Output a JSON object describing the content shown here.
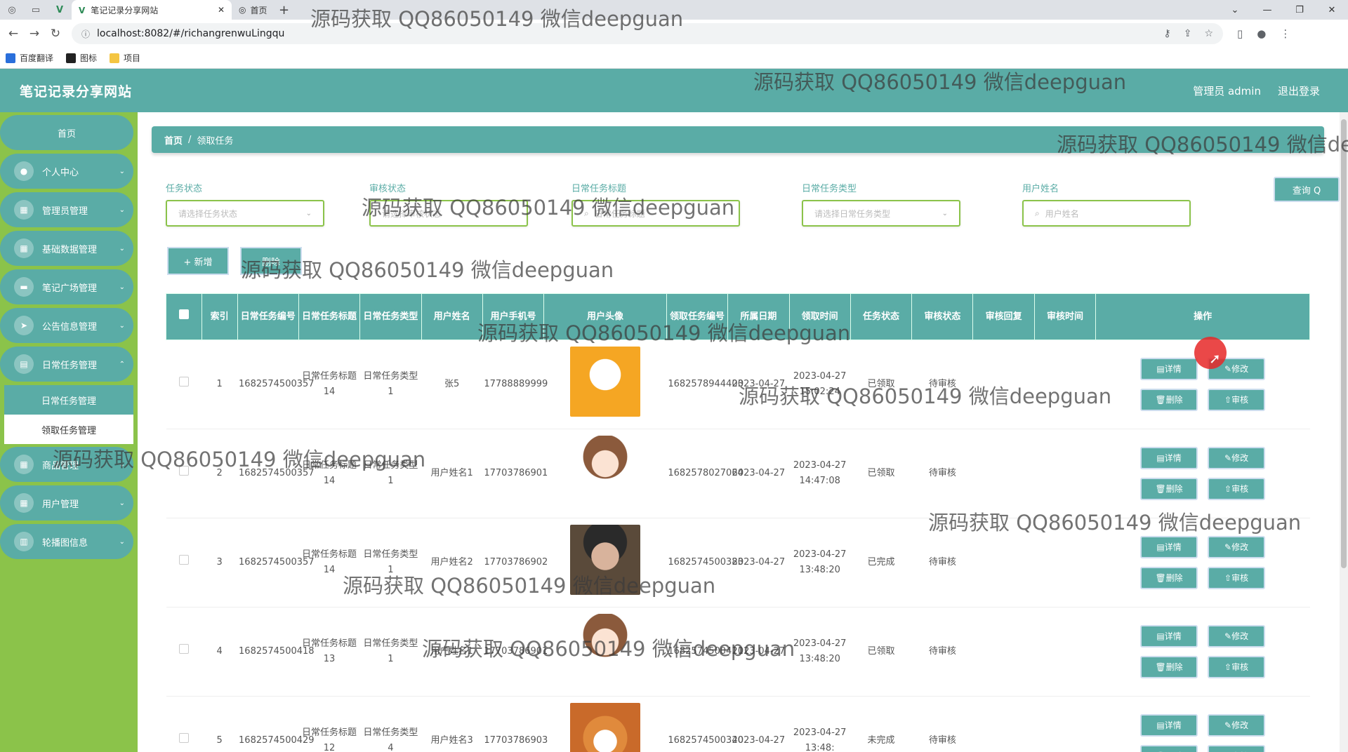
{
  "browser": {
    "tab_active_title": "笔记记录分享网站",
    "tab_second_title": "首页",
    "url": "localhost:8082/#/richangrenwuLingqu",
    "bookmarks": [
      "百度翻译",
      "图标",
      "项目"
    ]
  },
  "header": {
    "title": "笔记记录分享网站",
    "user_label": "管理员 admin",
    "logout": "退出登录"
  },
  "sidebar": {
    "home": "首页",
    "items": [
      {
        "label": "个人中心"
      },
      {
        "label": "管理员管理"
      },
      {
        "label": "基础数据管理"
      },
      {
        "label": "笔记广场管理"
      },
      {
        "label": "公告信息管理"
      },
      {
        "label": "日常任务管理"
      }
    ],
    "submenu": [
      "日常任务管理",
      "领取任务管理"
    ],
    "items_after": [
      {
        "label": "商品管理"
      },
      {
        "label": "用户管理"
      },
      {
        "label": "轮播图信息"
      }
    ]
  },
  "breadcrumb": {
    "home": "首页",
    "sep": "/",
    "current": "领取任务"
  },
  "filters": {
    "task_status": {
      "label": "任务状态",
      "placeholder": "请选择任务状态"
    },
    "review_status": {
      "label": "审核状态",
      "placeholder": "请选择审核状态"
    },
    "task_title": {
      "label": "日常任务标题",
      "placeholder": "日常任务标题"
    },
    "task_type": {
      "label": "日常任务类型",
      "placeholder": "请选择日常任务类型"
    },
    "user_name": {
      "label": "用户姓名",
      "placeholder": "用户姓名"
    },
    "query_button": "查询 Q"
  },
  "actions": {
    "add": "+ 新增",
    "delete": "删除"
  },
  "table": {
    "columns": [
      "",
      "索引",
      "日常任务编号",
      "日常任务标题",
      "日常任务类型",
      "用户姓名",
      "用户手机号",
      "用户头像",
      "领取任务编号",
      "所属日期",
      "领取时间",
      "任务状态",
      "审核状态",
      "审核回复",
      "审核时间",
      "操作"
    ],
    "rows": [
      {
        "idx": "1",
        "task_no": "1682574500357",
        "title": "日常任务标题14",
        "type": "日常任务类型1",
        "user": "张5",
        "phone": "17788889999",
        "avatar": "cartoon-boy",
        "claim_no": "1682578944403",
        "date": "2023-04-27",
        "claim_time": "2023-04-27 15:02:24",
        "status": "已领取",
        "review": "待审核",
        "reply": "",
        "review_time": ""
      },
      {
        "idx": "2",
        "task_no": "1682574500357",
        "title": "日常任务标题14",
        "type": "日常任务类型1",
        "user": "用户姓名1",
        "phone": "17703786901",
        "avatar": "cartoon-girl",
        "claim_no": "1682578027064",
        "date": "2023-04-27",
        "claim_time": "2023-04-27 14:47:08",
        "status": "已领取",
        "review": "待审核",
        "reply": "",
        "review_time": ""
      },
      {
        "idx": "3",
        "task_no": "1682574500357",
        "title": "日常任务标题14",
        "type": "日常任务类型1",
        "user": "用户姓名2",
        "phone": "17703786902",
        "avatar": "photo-man",
        "claim_no": "1682574500383",
        "date": "2023-04-27",
        "claim_time": "2023-04-27 13:48:20",
        "status": "已完成",
        "review": "待审核",
        "reply": "",
        "review_time": ""
      },
      {
        "idx": "4",
        "task_no": "1682574500418",
        "title": "日常任务标题13",
        "type": "日常任务类型1",
        "user": "用户姓名1",
        "phone": "17703786901",
        "avatar": "cartoon-girl",
        "claim_no": "1682574500411",
        "date": "2023-04-27",
        "claim_time": "2023-04-27 13:48:20",
        "status": "已领取",
        "review": "待审核",
        "reply": "",
        "review_time": ""
      },
      {
        "idx": "5",
        "task_no": "1682574500429",
        "title": "日常任务标题12",
        "type": "日常任务类型4",
        "user": "用户姓名3",
        "phone": "17703786903",
        "avatar": "dog",
        "claim_no": "1682574500340",
        "date": "2023-04-27",
        "claim_time": "2023-04-27 13:48:",
        "status": "未完成",
        "review": "待审核",
        "reply": "",
        "review_time": ""
      }
    ],
    "op_labels": {
      "detail": "详情",
      "edit": "修改",
      "delete": "删除",
      "review": "审核"
    }
  },
  "watermark": "源码获取 QQ86050149 微信deepguan",
  "colors": {
    "primary": "#5aaca6",
    "sidebar": "#8bc34a",
    "accent_border": "#8bc34a"
  }
}
